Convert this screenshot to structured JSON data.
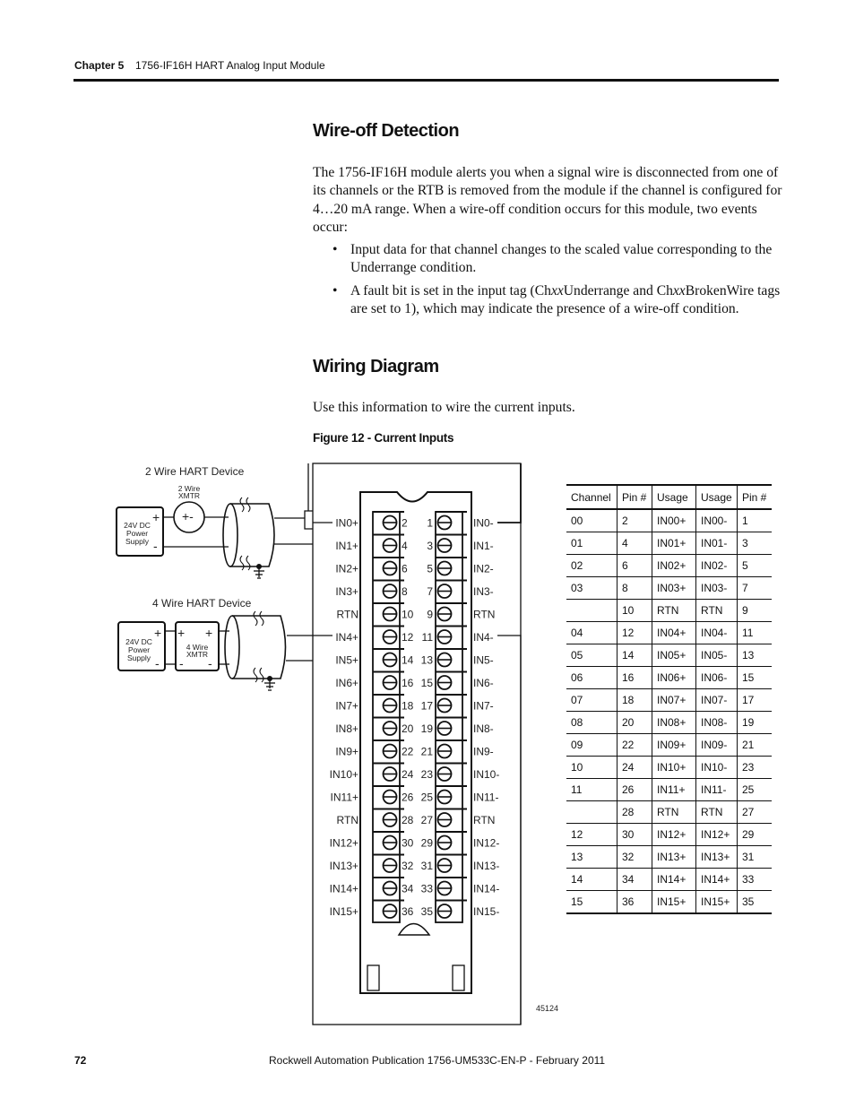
{
  "header": {
    "chapter": "Chapter 5",
    "title": "1756-IF16H HART Analog Input Module"
  },
  "section1": {
    "heading": "Wire-off Detection",
    "intro": "The 1756-IF16H module alerts you when a signal wire is disconnected from one of its channels or the RTB is removed from the module if the channel is configured for 4…20 mA range. When a wire-off condition occurs for this module, two events occur:",
    "bullets": [
      {
        "text": "Input data for that channel changes to the scaled value corresponding to the Underrange condition."
      },
      {
        "pre": "A fault bit is set in the input tag (Ch",
        "it1": "xx",
        "mid": "Underrange and Ch",
        "it2": "xx",
        "post": "BrokenWire tags are set to 1), which may indicate the presence of a wire-off condition."
      }
    ]
  },
  "section2": {
    "heading": "Wiring Diagram",
    "intro": "Use this information to wire the current inputs.",
    "figure_caption": "Figure 12 - Current Inputs"
  },
  "diagram": {
    "two_wire_title": "2 Wire HART Device",
    "two_wire_xmtr": [
      "2 Wire",
      "XMTR"
    ],
    "four_wire_title": "4 Wire HART Device",
    "four_wire_xmtr": [
      "4 Wire",
      "XMTR"
    ],
    "power_supply": [
      "24V DC",
      "Power",
      "Supply"
    ],
    "plus": "+",
    "minus": "-",
    "xmtr_symbol": "+-",
    "figure_id": "45124",
    "terminal_rows": [
      {
        "left_label": "IN0+",
        "left_pin": "2",
        "right_pin": "1",
        "right_label": "IN0-"
      },
      {
        "left_label": "IN1+",
        "left_pin": "4",
        "right_pin": "3",
        "right_label": "IN1-"
      },
      {
        "left_label": "IN2+",
        "left_pin": "6",
        "right_pin": "5",
        "right_label": "IN2-"
      },
      {
        "left_label": "IN3+",
        "left_pin": "8",
        "right_pin": "7",
        "right_label": "IN3-"
      },
      {
        "left_label": "RTN",
        "left_pin": "10",
        "right_pin": "9",
        "right_label": "RTN"
      },
      {
        "left_label": "IN4+",
        "left_pin": "12",
        "right_pin": "11",
        "right_label": "IN4-"
      },
      {
        "left_label": "IN5+",
        "left_pin": "14",
        "right_pin": "13",
        "right_label": "IN5-"
      },
      {
        "left_label": "IN6+",
        "left_pin": "16",
        "right_pin": "15",
        "right_label": "IN6-"
      },
      {
        "left_label": "IN7+",
        "left_pin": "18",
        "right_pin": "17",
        "right_label": "IN7-"
      },
      {
        "left_label": "IN8+",
        "left_pin": "20",
        "right_pin": "19",
        "right_label": "IN8-"
      },
      {
        "left_label": "IN9+",
        "left_pin": "22",
        "right_pin": "21",
        "right_label": "IN9-"
      },
      {
        "left_label": "IN10+",
        "left_pin": "24",
        "right_pin": "23",
        "right_label": "IN10-"
      },
      {
        "left_label": "IN11+",
        "left_pin": "26",
        "right_pin": "25",
        "right_label": "IN11-"
      },
      {
        "left_label": "RTN",
        "left_pin": "28",
        "right_pin": "27",
        "right_label": "RTN"
      },
      {
        "left_label": "IN12+",
        "left_pin": "30",
        "right_pin": "29",
        "right_label": "IN12-"
      },
      {
        "left_label": "IN13+",
        "left_pin": "32",
        "right_pin": "31",
        "right_label": "IN13-"
      },
      {
        "left_label": "IN14+",
        "left_pin": "34",
        "right_pin": "33",
        "right_label": "IN14-"
      },
      {
        "left_label": "IN15+",
        "left_pin": "36",
        "right_pin": "35",
        "right_label": "IN15-"
      }
    ]
  },
  "pin_table": {
    "columns": [
      "Channel",
      "Pin #",
      "Usage",
      "Usage",
      "Pin #"
    ],
    "rows": [
      [
        "00",
        "2",
        "IN00+",
        "IN00-",
        "1"
      ],
      [
        "01",
        "4",
        "IN01+",
        "IN01-",
        "3"
      ],
      [
        "02",
        "6",
        "IN02+",
        "IN02-",
        "5"
      ],
      [
        "03",
        "8",
        "IN03+",
        "IN03-",
        "7"
      ],
      [
        "",
        "10",
        "RTN",
        "RTN",
        "9"
      ],
      [
        "04",
        "12",
        "IN04+",
        "IN04-",
        "11"
      ],
      [
        "05",
        "14",
        "IN05+",
        "IN05-",
        "13"
      ],
      [
        "06",
        "16",
        "IN06+",
        "IN06-",
        "15"
      ],
      [
        "07",
        "18",
        "IN07+",
        "IN07-",
        "17"
      ],
      [
        "08",
        "20",
        "IN08+",
        "IN08-",
        "19"
      ],
      [
        "09",
        "22",
        "IN09+",
        "IN09-",
        "21"
      ],
      [
        "10",
        "24",
        "IN10+",
        "IN10-",
        "23"
      ],
      [
        "11",
        "26",
        "IN11+",
        "IN11-",
        "25"
      ],
      [
        "",
        "28",
        "RTN",
        "RTN",
        "27"
      ],
      [
        "12",
        "30",
        "IN12+",
        "IN12+",
        "29"
      ],
      [
        "13",
        "32",
        "IN13+",
        "IN13+",
        "31"
      ],
      [
        "14",
        "34",
        "IN14+",
        "IN14+",
        "33"
      ],
      [
        "15",
        "36",
        "IN15+",
        "IN15+",
        "35"
      ]
    ]
  },
  "footer": {
    "page_number": "72",
    "publication": "Rockwell Automation Publication 1756-UM533C-EN-P - February 2011"
  }
}
